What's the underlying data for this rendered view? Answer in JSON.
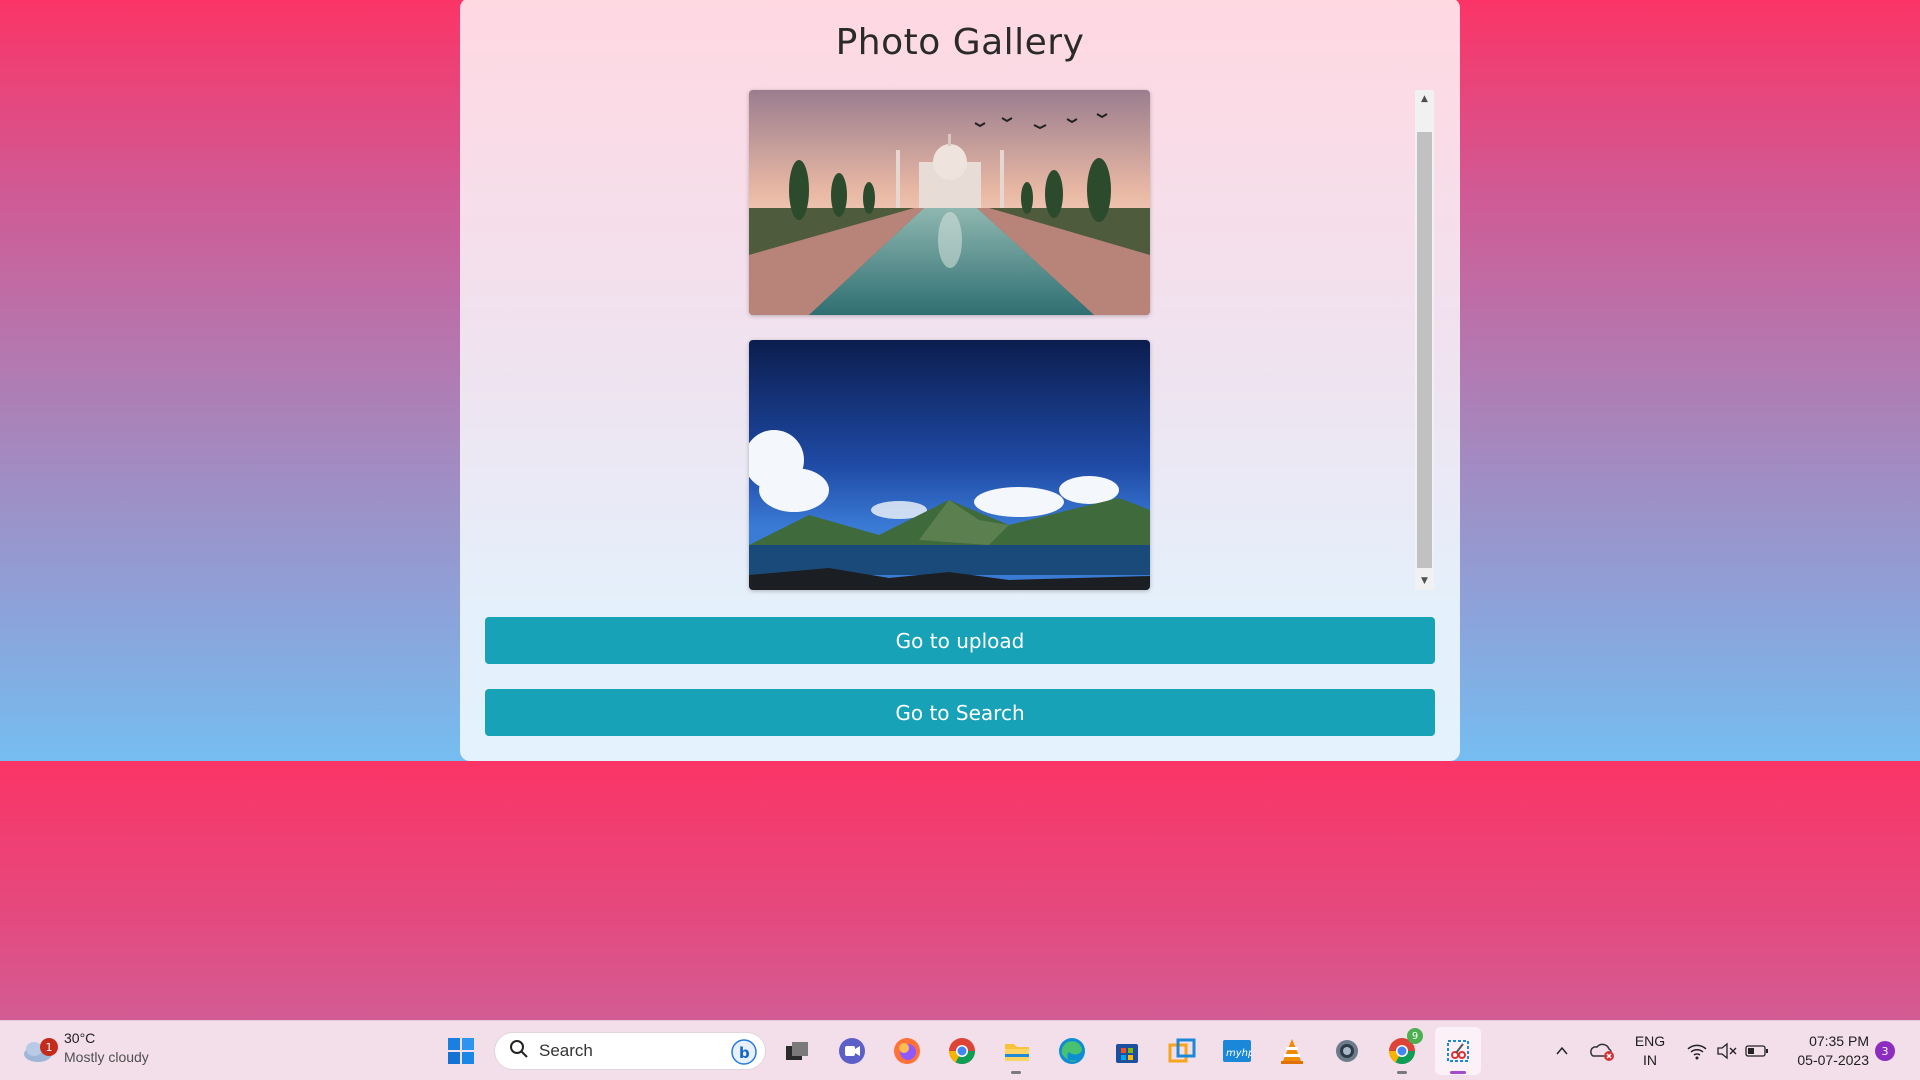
{
  "page": {
    "title": "Photo Gallery",
    "photos": [
      {
        "alt": "Taj Mahal"
      },
      {
        "alt": "Mountain lake"
      }
    ],
    "buttons": {
      "upload": "Go to upload",
      "search": "Go to Search"
    }
  },
  "colors": {
    "button": "#17a2b8",
    "bg_top": "#fb3466",
    "bg_bottom": "#6cc8f9"
  },
  "taskbar": {
    "weather": {
      "badge": "1",
      "temp": "30°C",
      "condition": "Mostly cloudy"
    },
    "search_placeholder": "Search",
    "apps": [
      "start-icon",
      "search-icon",
      "bing-icon",
      "task-view-icon",
      "teams-icon",
      "firefox-icon",
      "chrome-icon",
      "file-explorer-icon",
      "edge-icon",
      "store-icon",
      "remote-desktop-icon",
      "myhp-icon",
      "vlc-icon",
      "settings-icon",
      "chrome-profile-icon",
      "snipping-tool-icon"
    ],
    "chrome_badge": "9",
    "myhp_label": "myhp",
    "tray": {
      "language": "ENG",
      "region": "IN",
      "time": "07:35 PM",
      "date": "05-07-2023",
      "notifications": "3"
    }
  }
}
